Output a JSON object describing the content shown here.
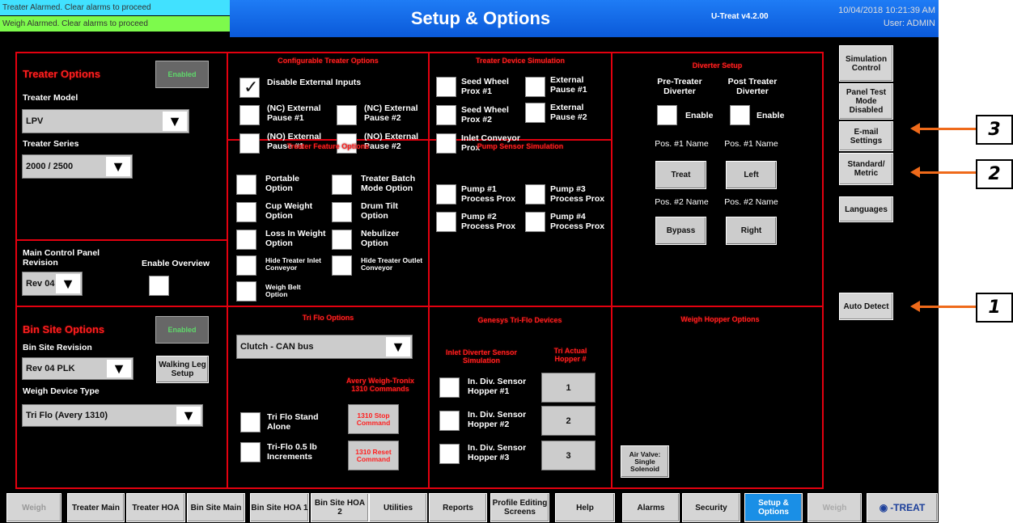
{
  "alarms": [
    "Treater Alarmed. Clear alarms to proceed",
    "Weigh Alarmed. Clear alarms to proceed"
  ],
  "header": {
    "title": "Setup & Options",
    "version": "U-Treat v4.2.00",
    "date": "10/04/2018 10:21:39 AM",
    "user": "User: ADMIN"
  },
  "treater_options": {
    "title": "Treater Options",
    "toggle": "Enabled",
    "model_label": "Treater Model",
    "model_value": "LPV",
    "series_label": "Treater Series",
    "series_value": "2000 / 2500"
  },
  "main_panel": {
    "revision_label": "Main Control Panel Revision",
    "revision_value": "Rev 04",
    "overview_label": "Enable Overview"
  },
  "bin_site": {
    "title": "Bin Site Options",
    "toggle": "Enabled",
    "revision_label": "Bin Site Revision",
    "revision_value": "Rev 04 PLK",
    "walking_leg": "Walking Leg Setup",
    "weigh_label": "Weigh Device Type",
    "weigh_value": "Tri Flo (Avery 1310)"
  },
  "configurable": {
    "title": "Configurable Treater Options",
    "disable_ext": "Disable External Inputs",
    "nc1": "(NC) External Pause #1",
    "nc2": "(NC) External Pause #2",
    "no1": "(NO) External Pause #1",
    "no2": "(NO) External Pause #2"
  },
  "device_sim": {
    "title": "Treater Device Simulation",
    "swp1": "Seed Wheel Prox #1",
    "ext1": "External Pause #1",
    "swp2": "Seed Wheel Prox #2",
    "ext2": "External Pause #2",
    "inlet": "Inlet Conveyor Prox"
  },
  "treater_feature": {
    "title": "Treater Feature Options",
    "portable": "Portable Option",
    "batch": "Treater Batch Mode Option",
    "cup": "Cup Weight Option",
    "drum": "Drum Tilt Option",
    "loss": "Loss In Weight Option",
    "nebulizer": "Nebulizer Option",
    "hide_inlet": "Hide Treater Inlet Conveyor",
    "hide_outlet": "Hide Treater Outlet Conveyor",
    "weigh_belt": "Weigh Belt Option"
  },
  "pump_sim": {
    "title": "Pump Sensor Simulation",
    "p1": "Pump #1 Process Prox",
    "p3": "Pump #3 Process Prox",
    "p2": "Pump #2 Process Prox",
    "p4": "Pump #4 Process Prox"
  },
  "diverter": {
    "title": "Diverter Setup",
    "pre": "Pre-Treater Diverter",
    "post": "Post Treater Diverter",
    "enable": "Enable",
    "pos1": "Pos. #1 Name",
    "pos2": "Pos. #2 Name",
    "treat": "Treat",
    "left": "Left",
    "bypass": "Bypass",
    "right": "Right"
  },
  "triflo": {
    "title": "Tri Flo Options",
    "select": "Clutch - CAN bus",
    "avery": "Avery Weigh-Tronix 1310 Commands",
    "stand_alone": "Tri Flo Stand Alone",
    "increments": "Tri-Flo 0.5 lb Increments",
    "stop": "1310 Stop Command",
    "reset": "1310 Reset Command"
  },
  "hopper_sim": {
    "title": "Genesys Tri-Flo Devices",
    "sensor_head": "Inlet Diverter Sensor Simulation",
    "actual_head": "Tri Actual Hopper #",
    "s1": "In. Div. Sensor Hopper #1",
    "s2": "In. Div. Sensor Hopper #2",
    "s3": "In. Div. Sensor Hopper #3",
    "h": [
      "1",
      "2",
      "3"
    ]
  },
  "weigh_hopper": {
    "title": "Weigh Hopper Options",
    "air_valve": "Air Valve: Single Solenoid"
  },
  "side": {
    "simulation": "Simulation Control",
    "panel_test": "Panel Test Mode Disabled",
    "email": "E-mail Settings",
    "standard": "Standard/ Metric",
    "languages": "Languages",
    "auto_detect": "Auto Detect"
  },
  "nav": [
    "Weigh",
    "Treater Main",
    "Treater HOA",
    "Bin Site Main",
    "Bin Site HOA 1",
    "Bin Site HOA 2",
    "Utilities",
    "Reports",
    "Profile Editing Screens",
    "Help",
    "Alarms",
    "Security",
    "Setup & Options",
    "Weigh"
  ],
  "brand": "-TREAT",
  "callouts": [
    "3",
    "2",
    "1"
  ],
  "colors": {
    "accent_red": "#e3000f",
    "title_blue": "#1f7cf5",
    "active_tab": "#1a8fe6",
    "callout_arrow": "#ef6a1a",
    "enabled_green": "#5fd86b"
  }
}
